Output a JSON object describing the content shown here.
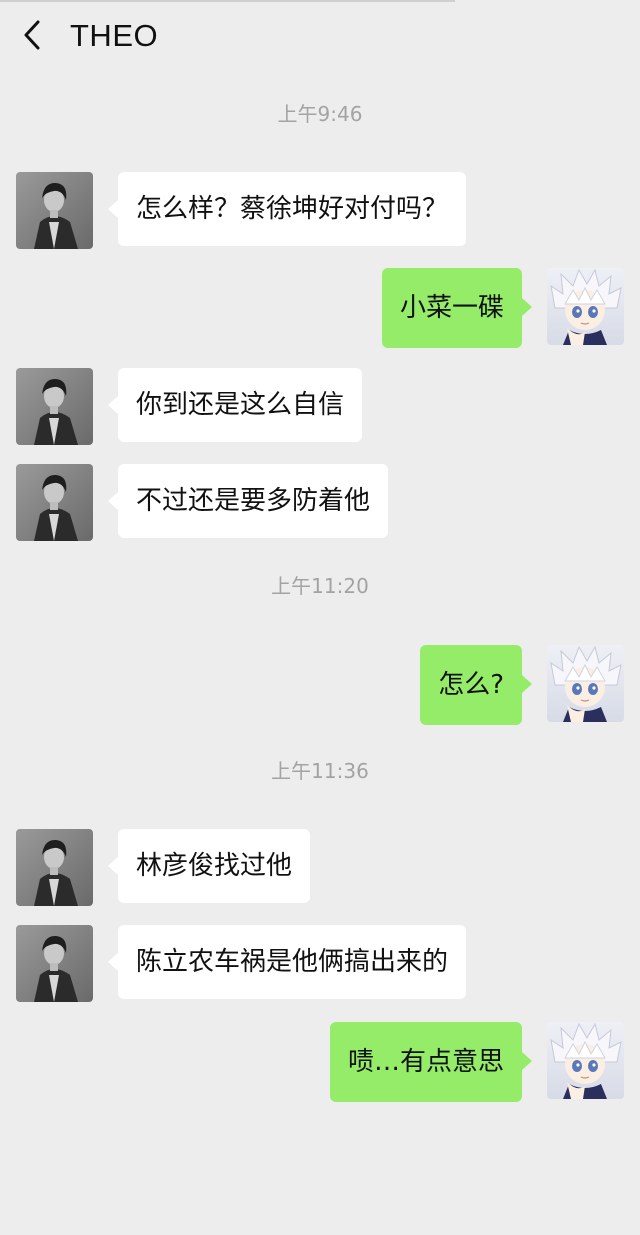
{
  "header": {
    "back_label": "<",
    "title": "THEO"
  },
  "messages": [
    {
      "type": "time",
      "text": "上午9:46"
    },
    {
      "type": "recv",
      "text": "怎么样？蔡徐坤好对付吗？"
    },
    {
      "type": "sent",
      "text": "小菜一碟"
    },
    {
      "type": "recv",
      "text": "你到还是这么自信"
    },
    {
      "type": "recv",
      "text": "不过还是要多防着他"
    },
    {
      "type": "time",
      "text": "上午11:20"
    },
    {
      "type": "sent",
      "text": "怎么?"
    },
    {
      "type": "time",
      "text": "上午11:36"
    },
    {
      "type": "recv",
      "text": "林彦俊找过他"
    },
    {
      "type": "recv",
      "text": "陈立农车祸是他俩搞出来的"
    },
    {
      "type": "sent",
      "text": "啧…有点意思"
    }
  ],
  "colors": {
    "background": "#ededed",
    "received_bubble": "#ffffff",
    "sent_bubble": "#95ec69",
    "timestamp_text": "#a3a3a3"
  },
  "icons": {
    "back": "chevron-left-icon",
    "contact_avatar": "grayscale-portrait",
    "self_avatar": "anime-portrait-white-hair"
  }
}
